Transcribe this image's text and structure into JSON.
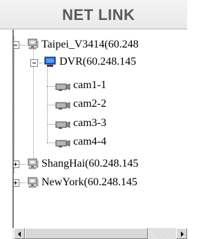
{
  "header": {
    "title": "NET LINK"
  },
  "tree": {
    "sites": [
      {
        "label": "Taipei_V3414(60.248",
        "expanded": true,
        "devices": [
          {
            "label": "DVR(60.248.145",
            "expanded": true,
            "cameras": [
              "cam1-1",
              "cam2-2",
              "cam3-3",
              "cam4-4"
            ]
          }
        ]
      },
      {
        "label": "ShangHai(60.248.145",
        "expanded": false
      },
      {
        "label": "NewYork(60.248.145",
        "expanded": false
      }
    ]
  },
  "scrollbar": {
    "orientation": "horizontal"
  }
}
